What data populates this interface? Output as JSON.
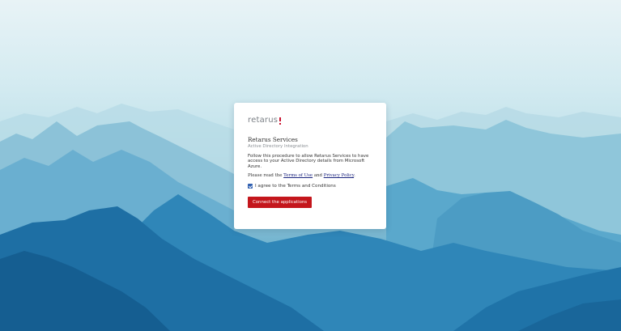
{
  "brand": {
    "logo_text": "retarus",
    "accent_color": "#c8102e"
  },
  "card": {
    "title": "Retarus Services",
    "subtitle": "Active Directory Integration",
    "description": "Follow this procedure to allow Retarus Services to have access to your Active Directory details from Microsoft Azure.",
    "read_prefix": "Please read the ",
    "terms_link": "Terms of Use",
    "read_and": " and ",
    "privacy_link": "Privacy Policy",
    "read_suffix": ".",
    "agree_label": "I agree to the Terms and Conditions",
    "agree_checked": true,
    "button_label": "Connect the applications",
    "button_color": "#c4161c"
  },
  "background": {
    "description_icon": "mountain-landscape"
  }
}
